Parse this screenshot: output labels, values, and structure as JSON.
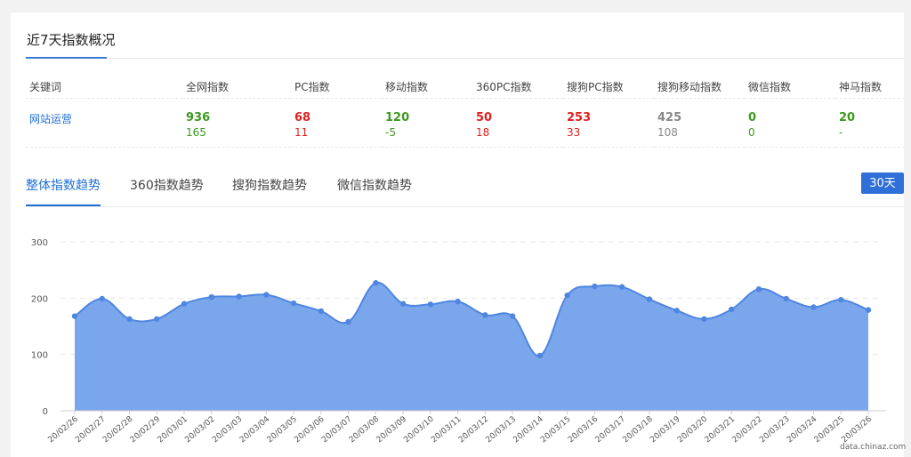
{
  "section_title": "近7天指数概况",
  "table": {
    "headers": [
      "关键词",
      "全网指数",
      "PC指数",
      "移动指数",
      "360PC指数",
      "搜狗PC指数",
      "搜狗移动指数",
      "微信指数",
      "神马指数"
    ],
    "row": {
      "keyword": "网站运营",
      "cells": [
        {
          "main": "936",
          "sub": "165",
          "color": "#3c9a1f"
        },
        {
          "main": "68",
          "sub": "11",
          "color": "#e02020"
        },
        {
          "main": "120",
          "sub": "-5",
          "color": "#3c9a1f"
        },
        {
          "main": "50",
          "sub": "18",
          "color": "#e02020"
        },
        {
          "main": "253",
          "sub": "33",
          "color": "#e02020"
        },
        {
          "main": "425",
          "sub": "108",
          "color": "#888888"
        },
        {
          "main": "0",
          "sub": "0",
          "color": "#3c9a1f"
        },
        {
          "main": "20",
          "sub": "-",
          "color": "#3c9a1f"
        }
      ]
    }
  },
  "tabs": [
    "整体指数趋势",
    "360指数趋势",
    "搜狗指数趋势",
    "微信指数趋势"
  ],
  "active_tab": 0,
  "range_button": "30天",
  "watermark": "data.chinaz.com",
  "colors": {
    "accent": "#1f6fd6",
    "area_fill": "#7aa6ec",
    "line": "#4f86e0"
  },
  "chart_data": {
    "type": "area",
    "title": "",
    "xlabel": "",
    "ylabel": "",
    "ylim": [
      0,
      300
    ],
    "yticks": [
      0,
      100,
      200,
      300
    ],
    "grid": true,
    "x": [
      "20/02/26",
      "20/02/27",
      "20/02/28",
      "20/02/29",
      "20/03/01",
      "20/03/02",
      "20/03/03",
      "20/03/04",
      "20/03/05",
      "20/03/06",
      "20/03/07",
      "20/03/08",
      "20/03/09",
      "20/03/10",
      "20/03/11",
      "20/03/12",
      "20/03/13",
      "20/03/14",
      "20/03/15",
      "20/03/16",
      "20/03/17",
      "20/03/18",
      "20/03/19",
      "20/03/20",
      "20/03/21",
      "20/03/22",
      "20/03/23",
      "20/03/24",
      "20/03/25",
      "20/03/26"
    ],
    "series": [
      {
        "values": [
          168,
          199,
          163,
          163,
          190,
          202,
          203,
          206,
          191,
          177,
          158,
          227,
          190,
          189,
          194,
          170,
          168,
          98,
          205,
          221,
          220,
          198,
          178,
          163,
          180,
          216,
          199,
          184,
          197,
          179
        ]
      }
    ]
  }
}
